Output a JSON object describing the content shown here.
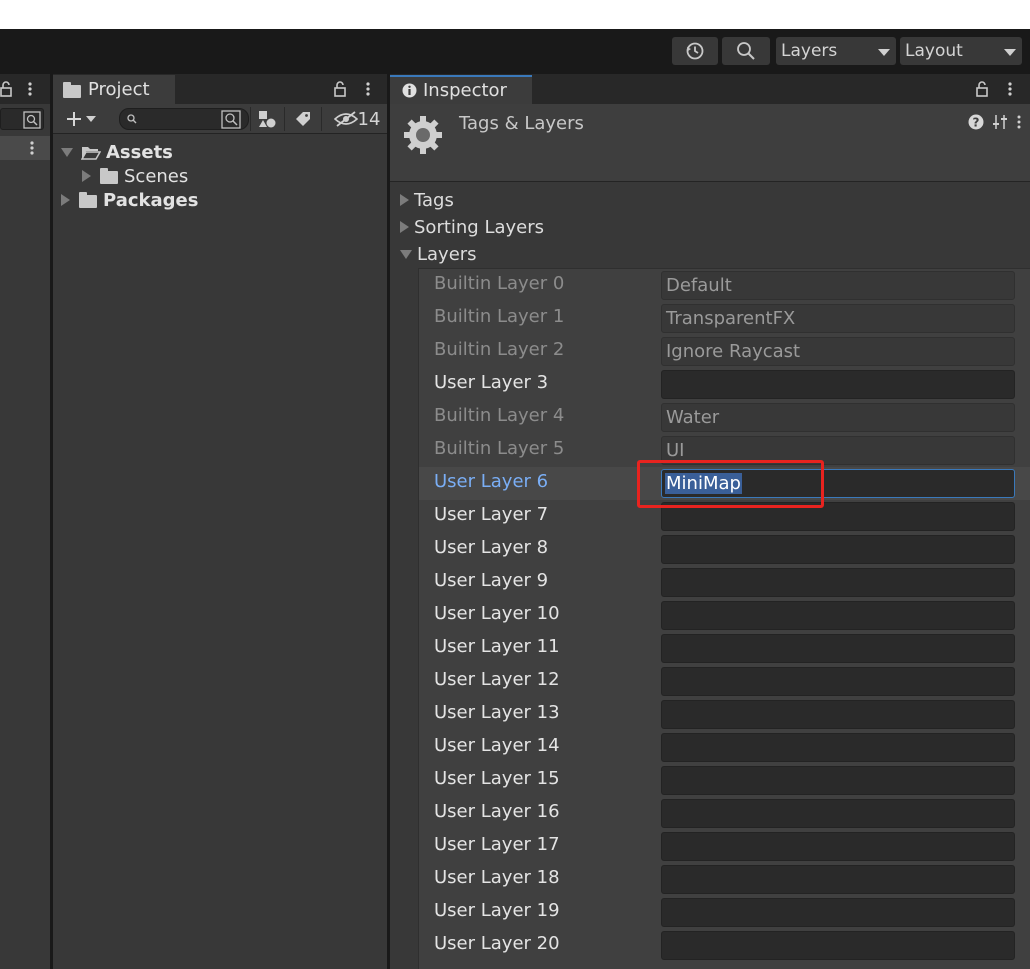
{
  "toolbar": {
    "layers_dropdown": "Layers",
    "layout_dropdown": "Layout"
  },
  "project": {
    "tab_label": "Project",
    "hidden_count": "14",
    "tree": [
      {
        "label": "Assets",
        "expanded": true
      },
      {
        "label": "Scenes",
        "expanded": false
      },
      {
        "label": "Packages",
        "expanded": false
      }
    ]
  },
  "inspector": {
    "tab_label": "Inspector",
    "title": "Tags & Layers",
    "foldouts": {
      "tags": "Tags",
      "sorting_layers": "Sorting Layers",
      "layers": "Layers"
    },
    "layers": [
      {
        "label": "Builtin Layer 0",
        "value": "Default"
      },
      {
        "label": "Builtin Layer 1",
        "value": "TransparentFX"
      },
      {
        "label": "Builtin Layer 2",
        "value": "Ignore Raycast"
      },
      {
        "label": "User Layer 3",
        "value": ""
      },
      {
        "label": "Builtin Layer 4",
        "value": "Water"
      },
      {
        "label": "Builtin Layer 5",
        "value": "UI"
      },
      {
        "label": "User Layer 6",
        "value": "MiniMap"
      },
      {
        "label": "User Layer 7",
        "value": ""
      },
      {
        "label": "User Layer 8",
        "value": ""
      },
      {
        "label": "User Layer 9",
        "value": ""
      },
      {
        "label": "User Layer 10",
        "value": ""
      },
      {
        "label": "User Layer 11",
        "value": ""
      },
      {
        "label": "User Layer 12",
        "value": ""
      },
      {
        "label": "User Layer 13",
        "value": ""
      },
      {
        "label": "User Layer 14",
        "value": ""
      },
      {
        "label": "User Layer 15",
        "value": ""
      },
      {
        "label": "User Layer 16",
        "value": ""
      },
      {
        "label": "User Layer 17",
        "value": ""
      },
      {
        "label": "User Layer 18",
        "value": ""
      },
      {
        "label": "User Layer 19",
        "value": ""
      },
      {
        "label": "User Layer 20",
        "value": ""
      }
    ]
  },
  "colors": {
    "selection_blue": "#3a79bb",
    "highlight_red": "#e8231f"
  }
}
